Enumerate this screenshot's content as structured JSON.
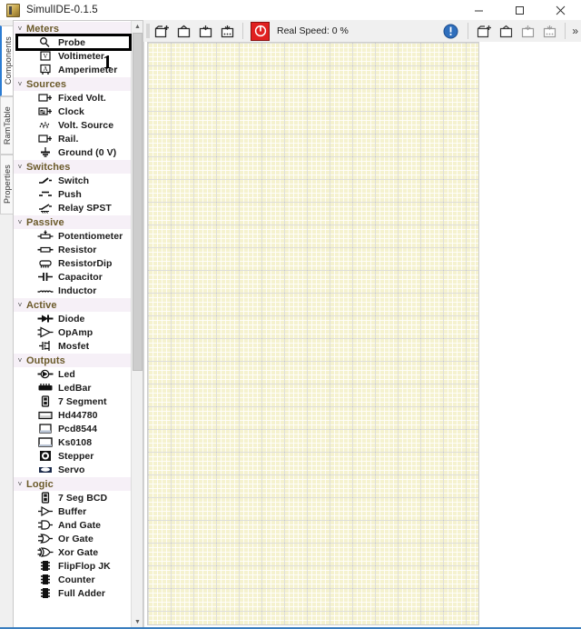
{
  "window": {
    "title": "SimulIDE-0.1.5",
    "app_icon": "simulide-icon",
    "controls": [
      {
        "name": "minimize-button",
        "glyph": "─"
      },
      {
        "name": "maximize-button",
        "glyph": "☐"
      },
      {
        "name": "close-button",
        "glyph": "✕"
      }
    ]
  },
  "side_tabs": [
    {
      "label": "Components",
      "active": true
    },
    {
      "label": "RamTable",
      "active": false
    },
    {
      "label": "Properties",
      "active": false
    }
  ],
  "toolbar": {
    "buttons": [
      {
        "name": "new-circuit-button",
        "icon": "new-circuit-icon",
        "label": "New Circuit"
      },
      {
        "name": "open-circuit-button",
        "icon": "open-circuit-icon",
        "label": "Open Circuit"
      },
      {
        "name": "save-circuit-button",
        "icon": "save-circuit-icon",
        "label": "Save Circuit"
      },
      {
        "name": "save-as-button",
        "icon": "save-as-icon",
        "label": "Save Circuit As"
      }
    ],
    "power_button": {
      "name": "power-button",
      "label": "Power Circuit",
      "color": "#e02020"
    },
    "speed_text": "Real Speed: 0 %",
    "info_button": {
      "name": "info-button",
      "label": "Info"
    },
    "right_buttons": [
      {
        "name": "new-file-button",
        "icon": "new-file-icon",
        "label": "New"
      },
      {
        "name": "open-file-button",
        "icon": "open-file-icon",
        "label": "Open"
      },
      {
        "name": "save-file-button",
        "icon": "save-file-icon",
        "label": "Save"
      },
      {
        "name": "save-file-as-button",
        "icon": "save-file-as-icon",
        "label": "Save As"
      }
    ],
    "overflow_label": "»"
  },
  "tree": {
    "groups": [
      {
        "name": "Meters",
        "arrow": "˅",
        "items": [
          {
            "label": "Probe",
            "icon": "probe-icon",
            "selected": true
          },
          {
            "label": "Voltimeter",
            "icon": "voltimeter-icon"
          },
          {
            "label": "Amperimeter",
            "icon": "amperimeter-icon"
          }
        ]
      },
      {
        "name": "Sources",
        "arrow": "˅",
        "items": [
          {
            "label": "Fixed Volt.",
            "icon": "fixed-volt-icon"
          },
          {
            "label": "Clock",
            "icon": "clock-icon"
          },
          {
            "label": "Volt. Source",
            "icon": "volt-source-icon"
          },
          {
            "label": "Rail.",
            "icon": "rail-icon"
          },
          {
            "label": "Ground (0 V)",
            "icon": "ground-icon"
          }
        ]
      },
      {
        "name": "Switches",
        "arrow": "˅",
        "items": [
          {
            "label": "Switch",
            "icon": "switch-icon"
          },
          {
            "label": "Push",
            "icon": "push-icon"
          },
          {
            "label": "Relay SPST",
            "icon": "relay-spst-icon"
          }
        ]
      },
      {
        "name": "Passive",
        "arrow": "˅",
        "items": [
          {
            "label": "Potentiometer",
            "icon": "potentiometer-icon"
          },
          {
            "label": "Resistor",
            "icon": "resistor-icon"
          },
          {
            "label": "ResistorDip",
            "icon": "resistordip-icon"
          },
          {
            "label": "Capacitor",
            "icon": "capacitor-icon"
          },
          {
            "label": "Inductor",
            "icon": "inductor-icon"
          }
        ]
      },
      {
        "name": "Active",
        "arrow": "˅",
        "items": [
          {
            "label": "Diode",
            "icon": "diode-icon"
          },
          {
            "label": "OpAmp",
            "icon": "opamp-icon"
          },
          {
            "label": "Mosfet",
            "icon": "mosfet-icon"
          }
        ]
      },
      {
        "name": "Outputs",
        "arrow": "˅",
        "items": [
          {
            "label": "Led",
            "icon": "led-icon"
          },
          {
            "label": "LedBar",
            "icon": "ledbar-icon"
          },
          {
            "label": "7 Segment",
            "icon": "seven-segment-icon"
          },
          {
            "label": "Hd44780",
            "icon": "hd44780-icon"
          },
          {
            "label": "Pcd8544",
            "icon": "pcd8544-icon"
          },
          {
            "label": "Ks0108",
            "icon": "ks0108-icon"
          },
          {
            "label": "Stepper",
            "icon": "stepper-icon"
          },
          {
            "label": "Servo",
            "icon": "servo-icon"
          }
        ]
      },
      {
        "name": "Logic",
        "arrow": "˅",
        "items": [
          {
            "label": "7 Seg BCD",
            "icon": "seven-seg-bcd-icon"
          },
          {
            "label": "Buffer",
            "icon": "buffer-icon"
          },
          {
            "label": "And Gate",
            "icon": "and-gate-icon"
          },
          {
            "label": "Or Gate",
            "icon": "or-gate-icon"
          },
          {
            "label": "Xor Gate",
            "icon": "xor-gate-icon"
          },
          {
            "label": "FlipFlop JK",
            "icon": "flipflop-jk-icon"
          },
          {
            "label": "Counter",
            "icon": "counter-icon"
          },
          {
            "label": "Full Adder",
            "icon": "full-adder-icon"
          }
        ]
      }
    ],
    "scrollbar": {
      "up_arrow": "▲",
      "down_arrow": "▼"
    }
  },
  "annotation": {
    "step_number": "1",
    "target": "Probe"
  },
  "canvas": {
    "background_color": "#f5f2cf",
    "grid_color": "#969696"
  }
}
